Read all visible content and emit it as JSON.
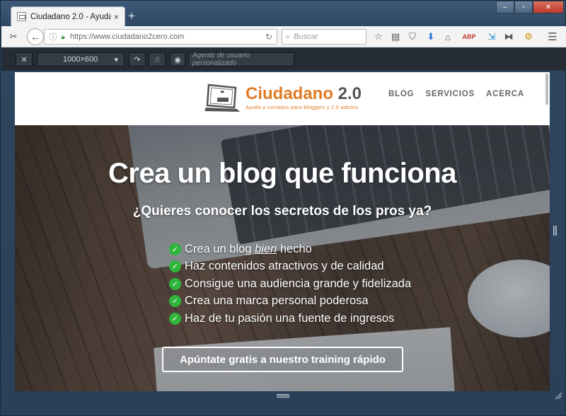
{
  "browser": {
    "tab_title": "Ciudadano 2.0 - Ayuda y c...",
    "tab_close": "×",
    "new_tab": "+",
    "url": "https://www.ciudadano2cero.com",
    "search_placeholder": "Buscar",
    "window_buttons": [
      "–",
      "▫",
      "✕"
    ]
  },
  "rdm": {
    "size": "1000×600",
    "user_agent_placeholder": "Agente de usuario personalizado"
  },
  "site": {
    "logo_name": "Ciudadano",
    "logo_version": " 2.0",
    "logo_tagline": "Ayuda y consejos para bloggers y 2.0 adictos",
    "nav": [
      "BLOG",
      "SERVICIOS",
      "ACERCA"
    ],
    "hero_title": "Crea un blog que funciona",
    "hero_subtitle": "¿Quieres conocer los secretos de los pros ya?",
    "checklist_first_pre": "Crea un blog ",
    "checklist_first_em": "bien",
    "checklist_first_post": " hecho",
    "checklist": [
      "Haz contenidos atractivos y de calidad",
      "Consigue una audiencia grande y fidelizada",
      "Crea una marca personal poderosa",
      "Haz de tu pasión una fuente de ingresos"
    ],
    "cta": "Apúntate gratis a nuestro training rápido"
  },
  "colors": {
    "brand_orange": "#e07b24",
    "check_green": "#2fb53a",
    "firefox_frame": "#2e4660"
  }
}
